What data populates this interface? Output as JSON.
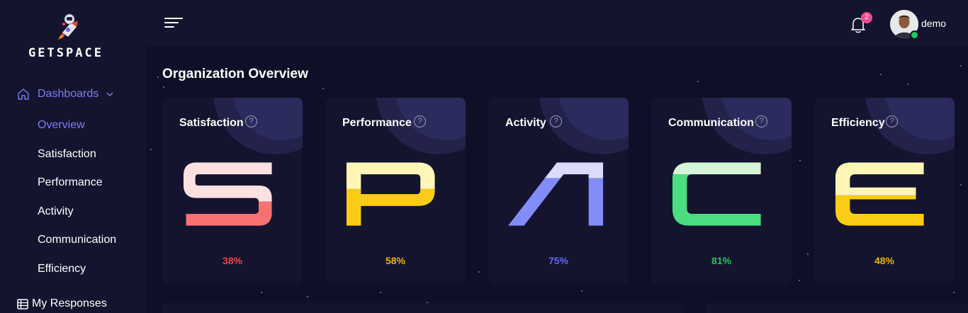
{
  "sidebar": {
    "brand": "GETSPACE",
    "group_label": "Dashboards",
    "items": [
      {
        "label": "Overview",
        "active": true
      },
      {
        "label": "Satisfaction"
      },
      {
        "label": "Performance"
      },
      {
        "label": "Activity"
      },
      {
        "label": "Communication"
      },
      {
        "label": "Efficiency"
      }
    ],
    "my_responses": "My Responses"
  },
  "header": {
    "notification_count": "2",
    "username": "demo"
  },
  "main": {
    "title": "Organization Overview",
    "cards": [
      {
        "title": "Satisfaction",
        "letter": "S",
        "percent": "38%",
        "value": 0.38,
        "top_color": "#fde0e0",
        "bottom_color": "#f87171",
        "pct_color": "#ef4444",
        "help": "?"
      },
      {
        "title": "Performance",
        "letter": "P",
        "percent": "58%",
        "value": 0.58,
        "top_color": "#fef6b7",
        "bottom_color": "#facc15",
        "pct_color": "#eab308",
        "help": "?"
      },
      {
        "title": "Activity",
        "letter": "A",
        "percent": "75%",
        "value": 0.75,
        "top_color": "#dcdcfa",
        "bottom_color": "#818cf8",
        "pct_color": "#6366f1",
        "help": "?"
      },
      {
        "title": "Communication",
        "letter": "C",
        "percent": "81%",
        "value": 0.81,
        "top_color": "#d6f5d8",
        "bottom_color": "#4ade80",
        "pct_color": "#22c55e",
        "help": "?"
      },
      {
        "title": "Efficiency",
        "letter": "E",
        "percent": "48%",
        "value": 0.48,
        "top_color": "#fef6b7",
        "bottom_color": "#facc15",
        "pct_color": "#eab308",
        "help": "?"
      }
    ]
  },
  "colors": {
    "background": "#0f0f27",
    "panel": "#14142f",
    "accent": "#7c7cf5"
  }
}
